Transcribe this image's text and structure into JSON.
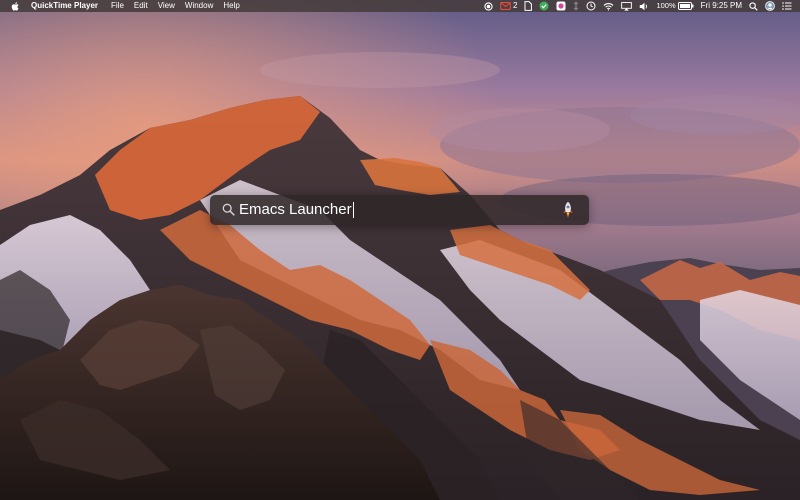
{
  "menubar": {
    "app_name": "QuickTime Player",
    "menus": [
      "File",
      "Edit",
      "View",
      "Window",
      "Help"
    ],
    "status": {
      "mail_count": "2",
      "battery_percent": "100%",
      "clock": "Fri 9:25 PM"
    }
  },
  "launcher": {
    "query": "Emacs Launcher",
    "result_icon": "rocket-icon"
  },
  "colors": {
    "menubar_bg": "#463c3c",
    "launcher_bg": "#2e2628",
    "text": "#ffffff",
    "alpenglow": "#d9683a"
  }
}
